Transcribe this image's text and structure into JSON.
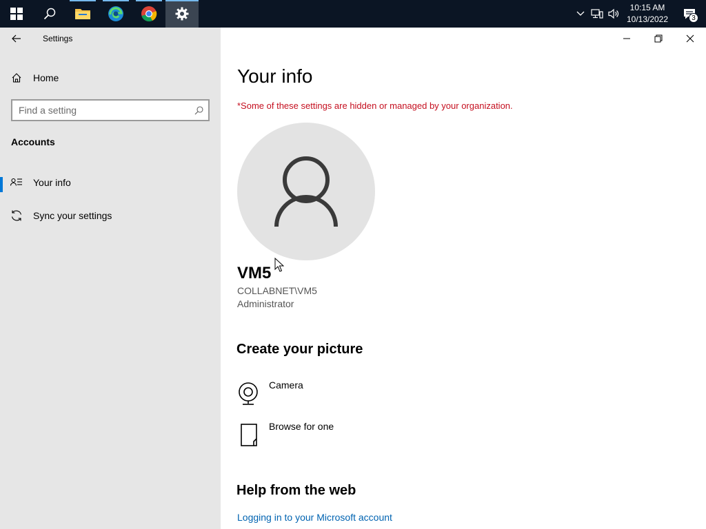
{
  "taskbar": {
    "apps": [
      {
        "name": "search-icon"
      },
      {
        "name": "file-explorer-icon"
      },
      {
        "name": "edge-icon"
      },
      {
        "name": "chrome-icon"
      },
      {
        "name": "settings-icon"
      }
    ],
    "time": "10:15 AM",
    "date": "10/13/2022",
    "notification_count": "3"
  },
  "window": {
    "title": "Settings"
  },
  "sidebar": {
    "home_label": "Home",
    "search_placeholder": "Find a setting",
    "section": "Accounts",
    "items": [
      {
        "label": "Your info",
        "icon": "contact-info-icon",
        "selected": true
      },
      {
        "label": "Sync your settings",
        "icon": "sync-icon",
        "selected": false
      }
    ]
  },
  "main": {
    "title": "Your info",
    "warning": "*Some of these settings are hidden or managed by your organization.",
    "user": {
      "name": "VM5",
      "domain": "COLLABNET\\VM5",
      "role": "Administrator"
    },
    "create_picture": {
      "heading": "Create your picture",
      "options": [
        {
          "label": "Camera",
          "icon": "webcam-icon"
        },
        {
          "label": "Browse for one",
          "icon": "document-icon"
        }
      ]
    },
    "help": {
      "heading": "Help from the web",
      "link": "Logging in to your Microsoft account"
    }
  },
  "colors": {
    "accent": "#0078d7",
    "warning": "#c50f1f",
    "link": "#0063b1",
    "sidebar_bg": "#e6e6e6",
    "taskbar_bg": "#0b1524"
  }
}
